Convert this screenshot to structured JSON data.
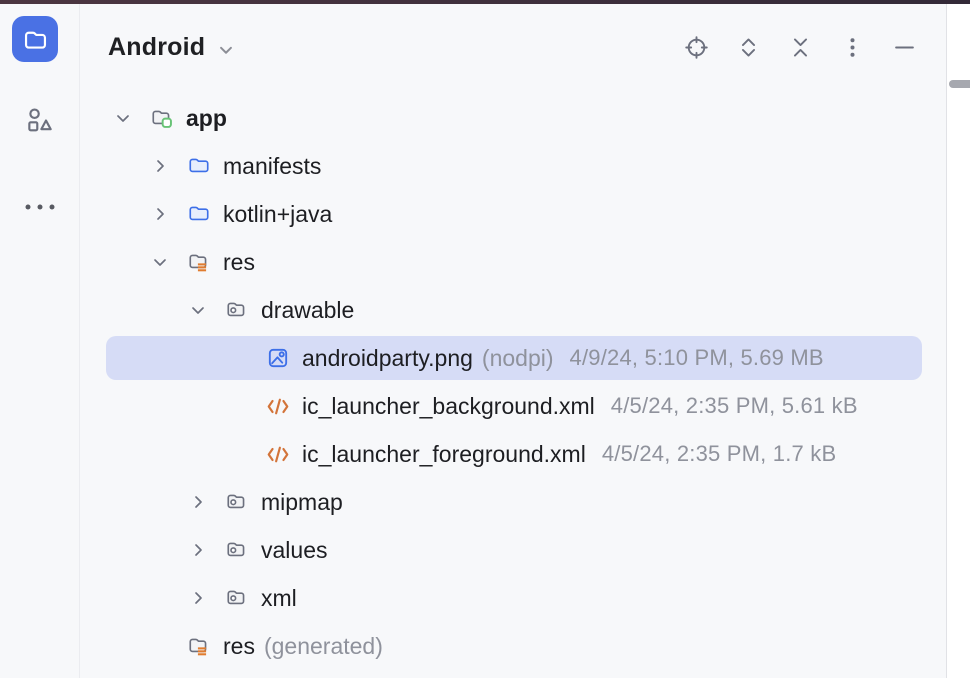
{
  "activity_bar": {
    "project_button": {
      "icon": "folder-icon",
      "selected": true
    },
    "resource_manager_button": {
      "icon": "resource-manager-icon"
    },
    "more_tool_windows_button": {
      "icon": "more-horizontal-icon"
    }
  },
  "header": {
    "title": "Android",
    "dropdown_icon": "chevron-down-icon",
    "actions": [
      {
        "name": "select-opened-file",
        "icon": "locate-target-icon"
      },
      {
        "name": "expand-all",
        "icon": "expand-all-icon"
      },
      {
        "name": "collapse-all",
        "icon": "collapse-all-icon"
      },
      {
        "name": "more-options",
        "icon": "kebab-vertical-icon"
      },
      {
        "name": "hide-tool-window",
        "icon": "minus-icon"
      }
    ]
  },
  "tree": {
    "items": [
      {
        "depth": 0,
        "expander": "expanded",
        "icon": "android-module-folder-icon",
        "label": "app",
        "bold": true
      },
      {
        "depth": 1,
        "expander": "collapsed",
        "icon": "blue-folder-icon",
        "label": "manifests"
      },
      {
        "depth": 1,
        "expander": "collapsed",
        "icon": "blue-folder-icon",
        "label": "kotlin+java"
      },
      {
        "depth": 1,
        "expander": "expanded",
        "icon": "resource-folder-icon",
        "label": "res"
      },
      {
        "depth": 2,
        "expander": "expanded",
        "icon": "drawable-folder-icon",
        "label": "drawable"
      },
      {
        "depth": 3,
        "expander": "none",
        "icon": "image-file-icon",
        "label": "androidparty.png",
        "suffix": "(nodpi)",
        "meta": "4/9/24, 5:10 PM, 5.69 MB",
        "selected": true
      },
      {
        "depth": 3,
        "expander": "none",
        "icon": "xml-file-icon",
        "label": "ic_launcher_background.xml",
        "meta": "4/5/24, 2:35 PM, 5.61 kB"
      },
      {
        "depth": 3,
        "expander": "none",
        "icon": "xml-file-icon",
        "label": "ic_launcher_foreground.xml",
        "meta": "4/5/24, 2:35 PM, 1.7 kB"
      },
      {
        "depth": 2,
        "expander": "collapsed",
        "icon": "drawable-folder-icon",
        "label": "mipmap"
      },
      {
        "depth": 2,
        "expander": "collapsed",
        "icon": "drawable-folder-icon",
        "label": "values"
      },
      {
        "depth": 2,
        "expander": "collapsed",
        "icon": "drawable-folder-icon",
        "label": "xml"
      },
      {
        "depth": 1,
        "expander": "none",
        "icon": "resource-folder-icon",
        "label": "res",
        "suffix": "(generated)"
      }
    ]
  },
  "colors": {
    "accent_blue": "#4a71e4",
    "icon_blue": "#3d6fe8",
    "icon_grey": "#6c707e",
    "icon_orange": "#d3743a",
    "icon_green": "#68c376",
    "selection_bg": "#d6dcf6",
    "panel_bg": "#f7f8fa",
    "text": "#1d1e22",
    "muted_text": "#8f929c"
  }
}
